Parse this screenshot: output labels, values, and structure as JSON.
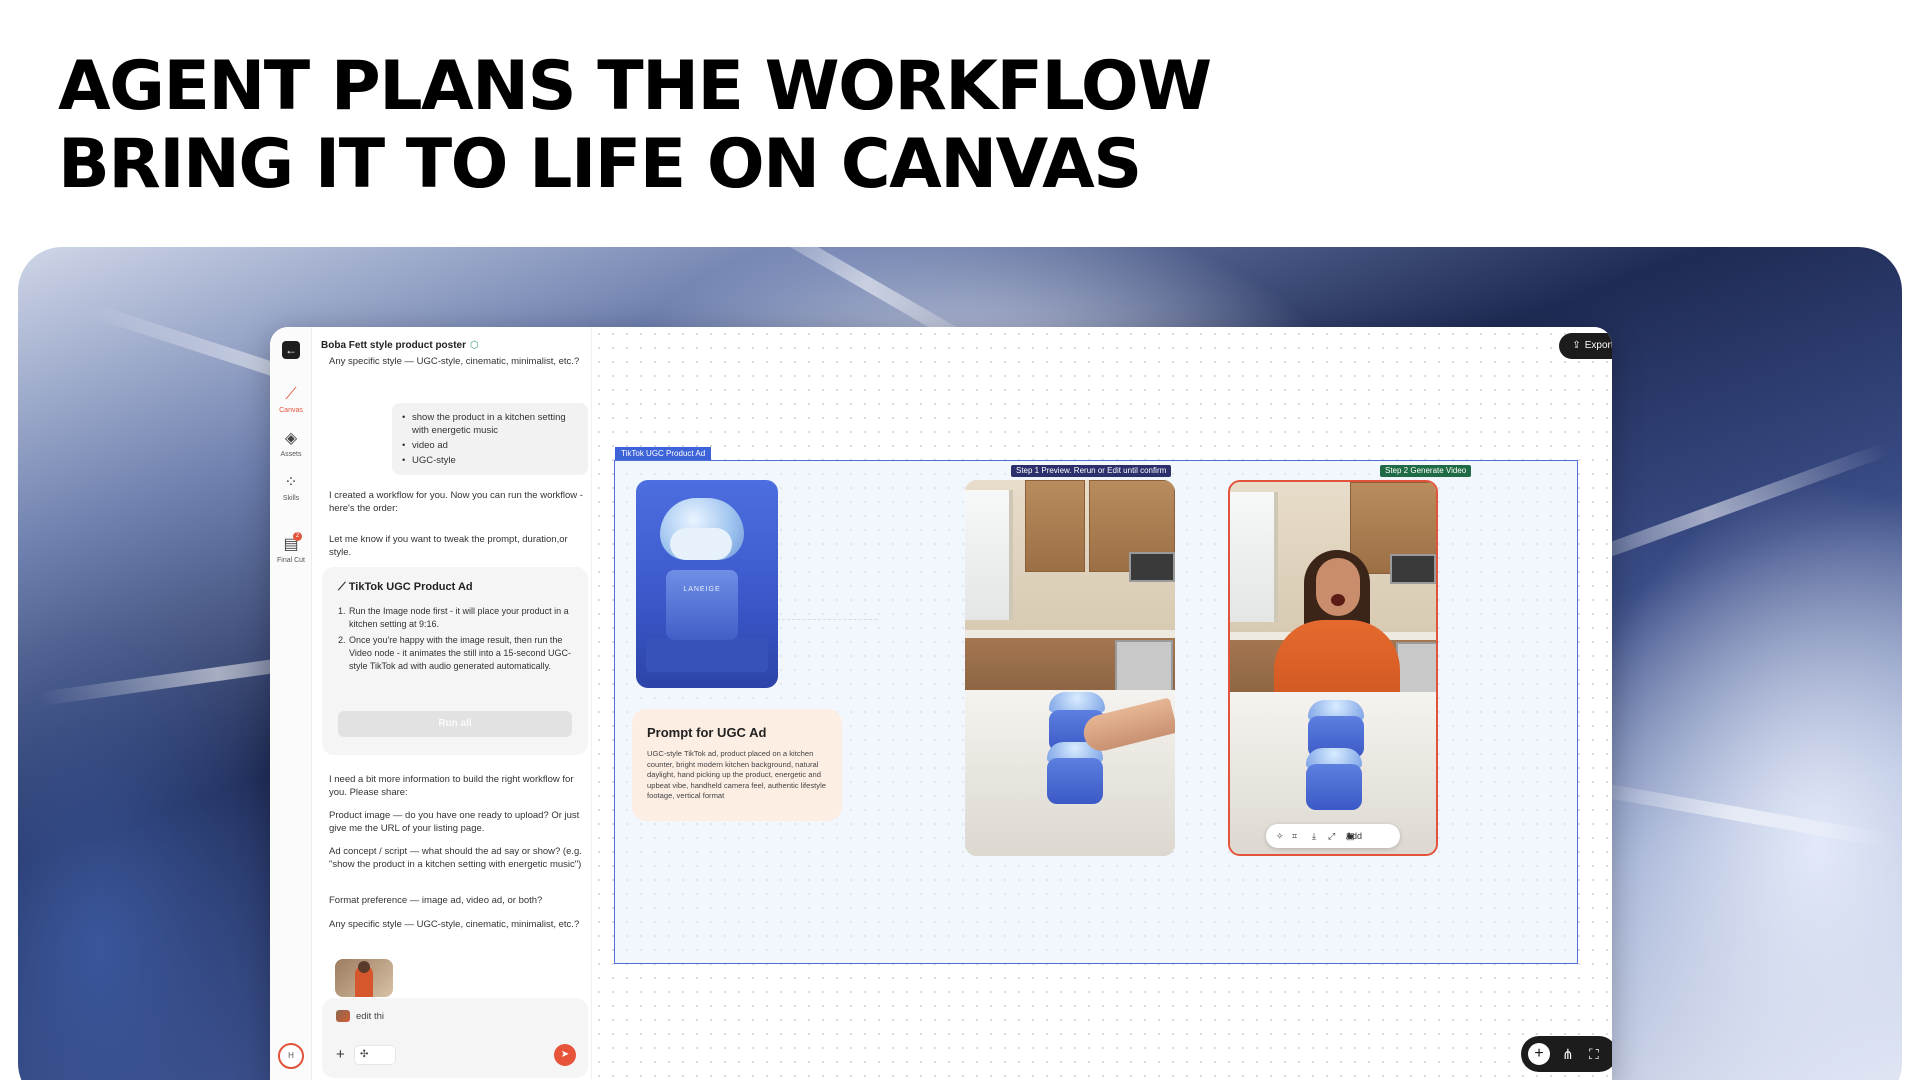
{
  "headline": {
    "line1": "AGENT PLANS THE WORKFLOW",
    "line2": "BRING IT TO LIFE ON CANVAS"
  },
  "rail": {
    "back_icon": "arrow-left-icon",
    "items": [
      {
        "label": "Canvas",
        "icon": "canvas-icon",
        "active": true
      },
      {
        "label": "Assets",
        "icon": "assets-icon",
        "active": false
      },
      {
        "label": "Skills",
        "icon": "skills-icon",
        "active": false
      },
      {
        "label": "Final Cut",
        "icon": "final-cut-icon",
        "active": false,
        "badge": "2"
      }
    ],
    "user_initial": "H"
  },
  "chat": {
    "title": "Boba Fett style product poster",
    "top_text": "Any specific style — UGC-style, cinematic, minimalist, etc.?",
    "user_message": [
      "show the product in a kitchen setting with energetic music",
      "video ad",
      "UGC-style"
    ],
    "reply1": "I created a workflow for you. Now you can run the workflow - here's the order:",
    "reply2": "Let me know if you want to tweak the prompt, duration,or style.",
    "workflow_card": {
      "title": "TikTok UGC Product Ad",
      "step1": "Run the Image node first - it will place your product in a kitchen setting at 9:16.",
      "step2": "Once you're happy with the image result, then run the Video node - it animates the still into a 15-second UGC-style TikTok ad with audio generated automatically.",
      "run_button": "Run all"
    },
    "msg_need_info": "I need a bit more information to build the right workflow for you. Please share:",
    "msg_product_image": "Product image — do you have one ready to upload? Or just give me the URL of your listing page.",
    "msg_ad_concept": "Ad concept / script — what should the ad say or show? (e.g. \"show the product in a kitchen setting with energetic music\")",
    "msg_format": "Format preference — image ad, video ad, or both?",
    "msg_style": "Any specific style — UGC-style, cinematic, minimalist, etc.?",
    "composer": {
      "draft": "edit thi",
      "plus_icon": "plus-icon",
      "mode_icon": "sparkle-icon",
      "send_icon": "send-icon"
    }
  },
  "canvas": {
    "export_label": "Export",
    "group_label": "TikTok UGC Product Ad",
    "step1_label": "Step 1 Preview. Rerun or Edit until confirm",
    "step2_label": "Step 2  Generate Video",
    "product_brand": "LANEIGE",
    "prompt_title": "Prompt for UGC Ad",
    "prompt_body": "UGC-style TikTok ad, product placed on a kitchen counter, bright modern kitchen background, natural daylight, hand picking up the product, energetic and upbeat vibe, handheld camera feel, authentic lifestyle footage, vertical format",
    "video_toolbar": {
      "add_to_chat": "Add to Chat",
      "icons": [
        "magic-icon",
        "crop-icon",
        "download-icon",
        "expand-icon",
        "chat-icon"
      ]
    },
    "bottom_bar_icons": [
      "plus-icon",
      "hierarchy-icon",
      "fit-screen-icon"
    ]
  },
  "colors": {
    "accent": "#e2533b",
    "selection": "#3d63d8",
    "step1_tag": "#2b2f6b",
    "step2_tag": "#1f6b45"
  }
}
